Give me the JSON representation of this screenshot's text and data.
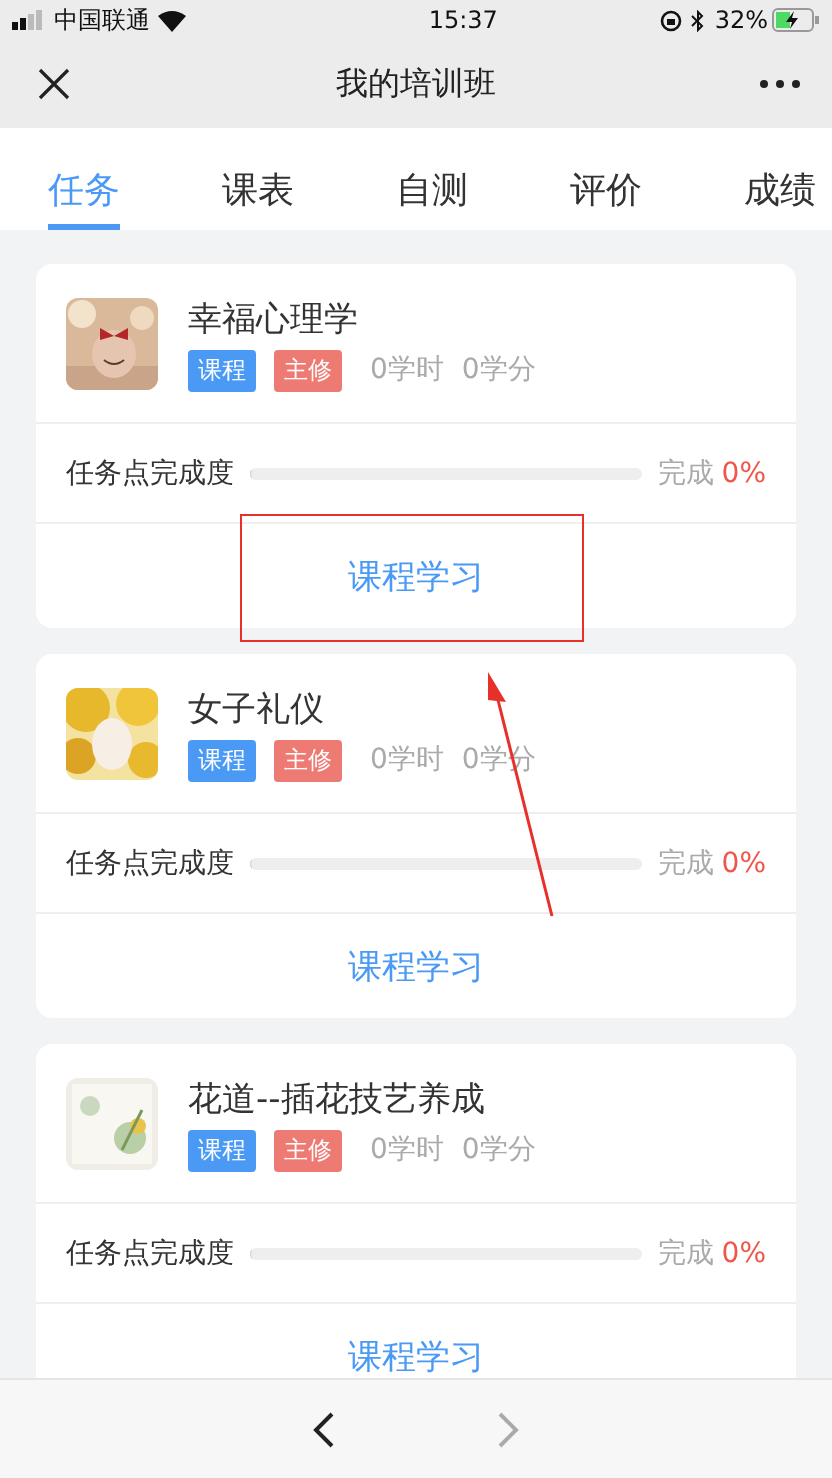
{
  "status_bar": {
    "carrier": "中国联通",
    "time": "15:37",
    "battery": "32%"
  },
  "nav": {
    "title": "我的培训班"
  },
  "tabs": [
    {
      "label": "任务",
      "selected": true
    },
    {
      "label": "课表",
      "selected": false
    },
    {
      "label": "自测",
      "selected": false
    },
    {
      "label": "评价",
      "selected": false
    },
    {
      "label": "成绩",
      "selected": false
    }
  ],
  "courses": [
    {
      "title": "幸福心理学",
      "tags": [
        {
          "label": "课程",
          "kind": "type"
        },
        {
          "label": "主修",
          "kind": "required"
        }
      ],
      "hours": "0学时",
      "credits": "0学分",
      "progress_label": "任务点完成度",
      "level": 0,
      "done_label": "完成",
      "percent": "0%",
      "action": "课程学习",
      "highlighted": true
    },
    {
      "title": "女子礼仪",
      "tags": [
        {
          "label": "课程",
          "kind": "type"
        },
        {
          "label": "主修",
          "kind": "required"
        }
      ],
      "hours": "0学时",
      "credits": "0学分",
      "progress_label": "任务点完成度",
      "level": 0,
      "done_label": "完成",
      "percent": "0%",
      "action": "课程学习",
      "highlighted": false
    },
    {
      "title": "花道--插花技艺养成",
      "tags": [
        {
          "label": "课程",
          "kind": "type"
        },
        {
          "label": "主修",
          "kind": "required"
        }
      ],
      "hours": "0学时",
      "credits": "0学分",
      "progress_label": "任务点完成度",
      "level": 0,
      "done_label": "完成",
      "percent": "0%",
      "action": "课程学习",
      "highlighted": false
    }
  ],
  "annotation_arrow": true
}
